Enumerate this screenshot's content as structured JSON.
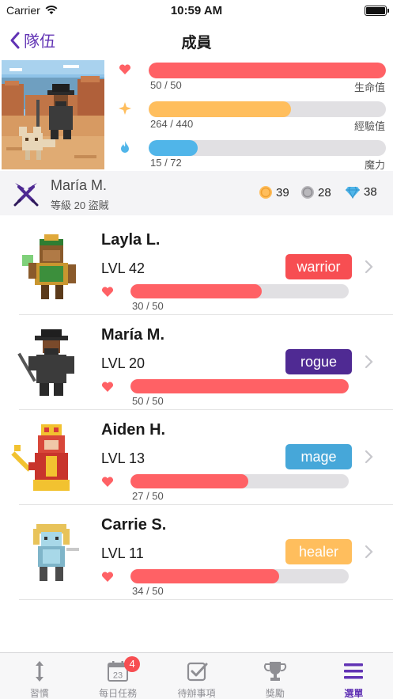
{
  "status_bar": {
    "carrier": "Carrier",
    "time": "10:59 AM"
  },
  "nav": {
    "back_label": "隊伍",
    "title": "成員"
  },
  "stats": {
    "health": {
      "value": "50 / 50",
      "label": "生命值",
      "fraction": 1.0,
      "color": "#ff6165"
    },
    "experience": {
      "value": "264 / 440",
      "label": "經驗值",
      "fraction": 0.6,
      "color": "#ffbe5d"
    },
    "mana": {
      "value": "15 / 72",
      "label": "魔力",
      "fraction": 0.208,
      "color": "#50b5e9"
    }
  },
  "profile": {
    "name": "María M.",
    "subtitle": "等級 20 盜賊",
    "gold": "39",
    "hourglasses": "28",
    "gems": "38",
    "icons": {
      "class": "rogue-daggers-icon",
      "gold": "gold-coin-icon",
      "hourglass": "hourglass-coin-icon",
      "gems": "gem-icon"
    }
  },
  "members": [
    {
      "name": "Layla L.",
      "level": "LVL 42",
      "class": "warrior",
      "class_color": "#f74e52",
      "hp": "30 / 50",
      "hp_fraction": 0.6
    },
    {
      "name": "María M.",
      "level": "LVL 20",
      "class": "rogue",
      "class_color": "#4f2a93",
      "hp": "50 / 50",
      "hp_fraction": 1.0
    },
    {
      "name": "Aiden H.",
      "level": "LVL 13",
      "class": "mage",
      "class_color": "#46a7d9",
      "hp": "27 / 50",
      "hp_fraction": 0.54
    },
    {
      "name": "Carrie S.",
      "level": "LVL 11",
      "class": "healer",
      "class_color": "#ffbe5d",
      "hp": "34 / 50",
      "hp_fraction": 0.68
    }
  ],
  "tabs": [
    {
      "label": "習慣",
      "icon": "habits-arrow-icon"
    },
    {
      "label": "每日任務",
      "icon": "calendar-icon",
      "badge": "4",
      "calendar_day": "23"
    },
    {
      "label": "待辦事項",
      "icon": "checkbox-icon"
    },
    {
      "label": "獎勵",
      "icon": "trophy-icon"
    },
    {
      "label": "選單",
      "icon": "menu-icon",
      "active": true
    }
  ],
  "colors": {
    "accent": "#6133b4",
    "hp": "#ff6165",
    "xp": "#ffbe5d",
    "mp": "#50b5e9"
  }
}
